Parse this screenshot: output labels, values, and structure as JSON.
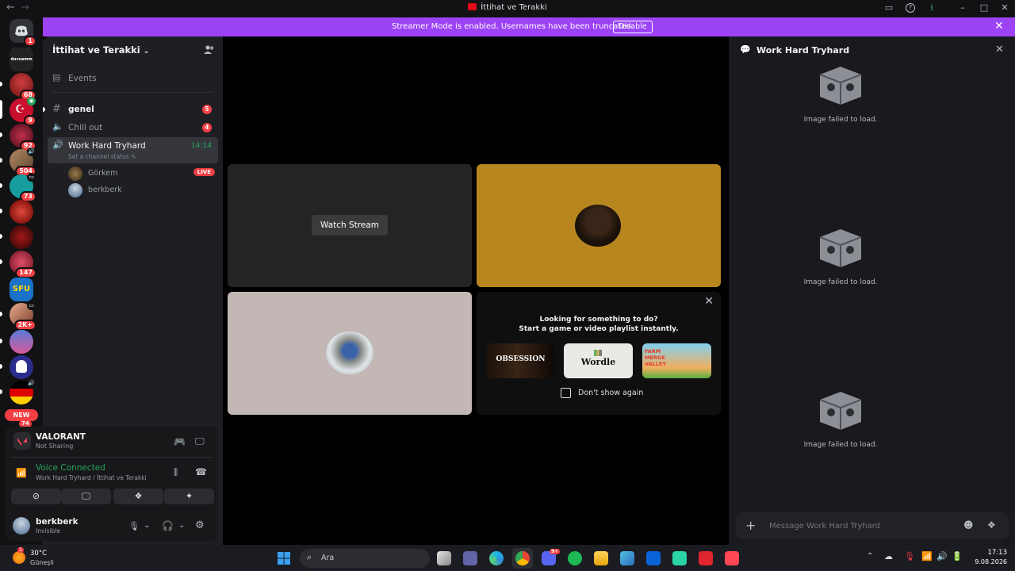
{
  "window": {
    "title": "İttihat ve Terakki"
  },
  "banner": {
    "message": "Streamer Mode is enabled. Usernames have been truncated.",
    "button": "Disable"
  },
  "rail": {
    "home_badge": "1",
    "servers": [
      {
        "name": "ducoamm",
        "badge": ""
      },
      {
        "name": "demirgazi",
        "badge": "68"
      },
      {
        "name": "ittihat",
        "badge": "9"
      },
      {
        "name": "feixe",
        "badge": "92"
      },
      {
        "name": "group-a",
        "badge": "504"
      },
      {
        "name": "teal",
        "badge": "73"
      },
      {
        "name": "red-cat",
        "badge": ""
      },
      {
        "name": "world",
        "badge": ""
      },
      {
        "name": "heart",
        "badge": "147"
      },
      {
        "name": "sfu",
        "badge": ""
      },
      {
        "name": "hand",
        "badge": "2K+"
      },
      {
        "name": "anime",
        "badge": ""
      },
      {
        "name": "ghost",
        "badge": ""
      },
      {
        "name": "germany",
        "badge": ""
      }
    ],
    "sfu_label": "SFU",
    "new_label": "NEW",
    "new_badge": "74"
  },
  "sidebar": {
    "server_name": "İttihat ve Terakki",
    "events_label": "Events",
    "channels": [
      {
        "name": "genel",
        "count": "5"
      },
      {
        "name": "Chill out",
        "count": "4"
      }
    ],
    "active_voice": {
      "name": "Work Hard Tryhard",
      "time": "14:14",
      "status": "Set a channel status"
    },
    "voice_users": [
      {
        "name": "Görkem",
        "live": "LIVE"
      },
      {
        "name": "berkberk",
        "live": ""
      }
    ]
  },
  "panel": {
    "activity_title": "VALORANT",
    "activity_sub": "Not Sharing",
    "voice_title": "Voice Connected",
    "voice_sub": "Work Hard Tryhard / İttihat ve Terakki",
    "user_name": "berkberk",
    "user_status": "Invisible"
  },
  "stage": {
    "watch_stream": "Watch Stream",
    "activity_line1": "Looking for something to do?",
    "activity_line2": "Start a game or video playlist instantly.",
    "games": [
      "OBSESSION",
      "Wordle",
      "FARM MERGE VALLEY"
    ],
    "dont_show": "Don't show again"
  },
  "chat": {
    "title": "Work Hard Tryhard",
    "image_failed": "Image failed to load.",
    "input_placeholder": "Message Work Hard Tryhard"
  },
  "taskbar": {
    "weather_temp": "30°C",
    "weather_label": "Güneşli",
    "search_placeholder": "Ara",
    "discord_badge": "9+",
    "time": "17:13",
    "date": "9.08.2026"
  },
  "colors": {
    "accent_purple": "#9c43f6",
    "mention_red": "#f23f43",
    "voice_green": "#23a55a"
  }
}
